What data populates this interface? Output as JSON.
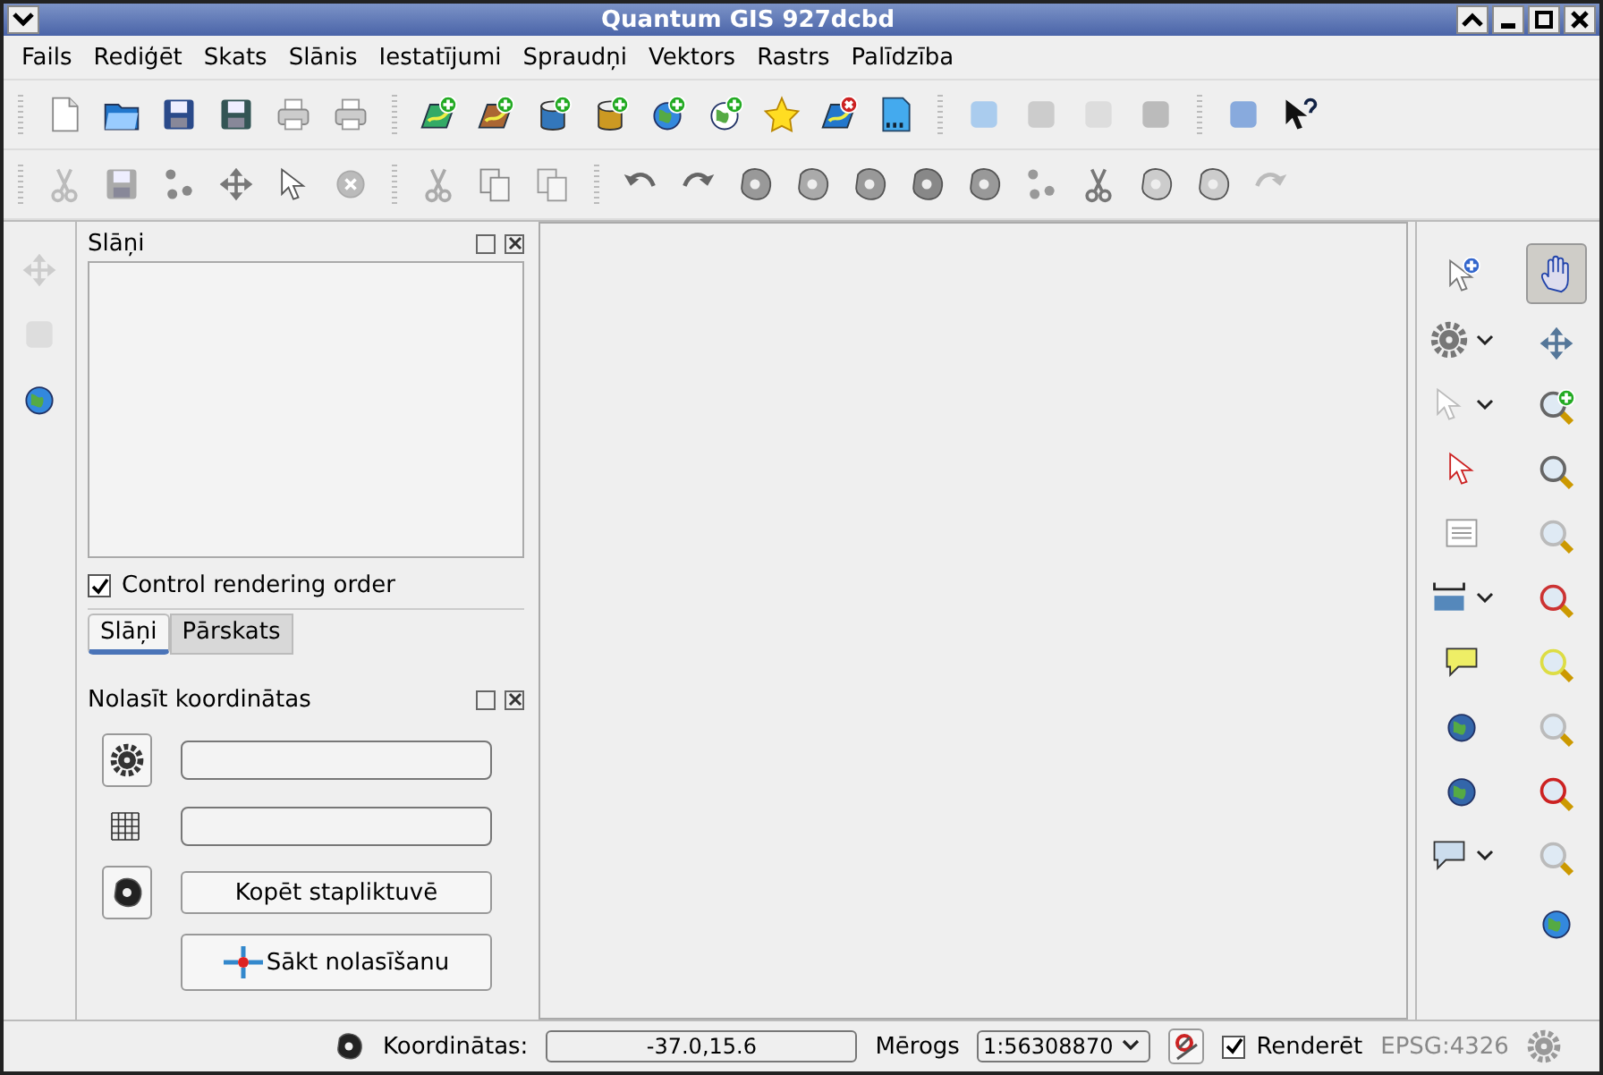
{
  "window": {
    "title": "Quantum GIS 927dcbd"
  },
  "menu": [
    {
      "label": "Fails"
    },
    {
      "label": "Rediģēt"
    },
    {
      "label": "Skats"
    },
    {
      "label": "Slānis"
    },
    {
      "label": "Iestatījumi"
    },
    {
      "label": "Spraudņi"
    },
    {
      "label": "Vektors"
    },
    {
      "label": "Rastrs"
    },
    {
      "label": "Palīdzība"
    }
  ],
  "layers_panel": {
    "title": "Slāņi",
    "control_rendering_order": {
      "label": "Control rendering order",
      "checked": true
    }
  },
  "dock_tabs": [
    {
      "label": "Slāņi",
      "selected": true
    },
    {
      "label": "Pārskats",
      "selected": false
    }
  ],
  "coordinate_panel": {
    "title": "Nolasīt koordinātas",
    "copy_button": "Kopēt stapliktuvē",
    "start_button": "Sākt nolasīšanu"
  },
  "pan_tool": {
    "selected": true
  },
  "status_bar": {
    "coordinates_label": "Koordinātas:",
    "coordinates_value": "-37.0,15.6",
    "scale_label": "Mērogs",
    "scale_value": "1:56308870",
    "render": {
      "label": "Renderēt",
      "checked": true
    },
    "crs": "EPSG:4326"
  }
}
